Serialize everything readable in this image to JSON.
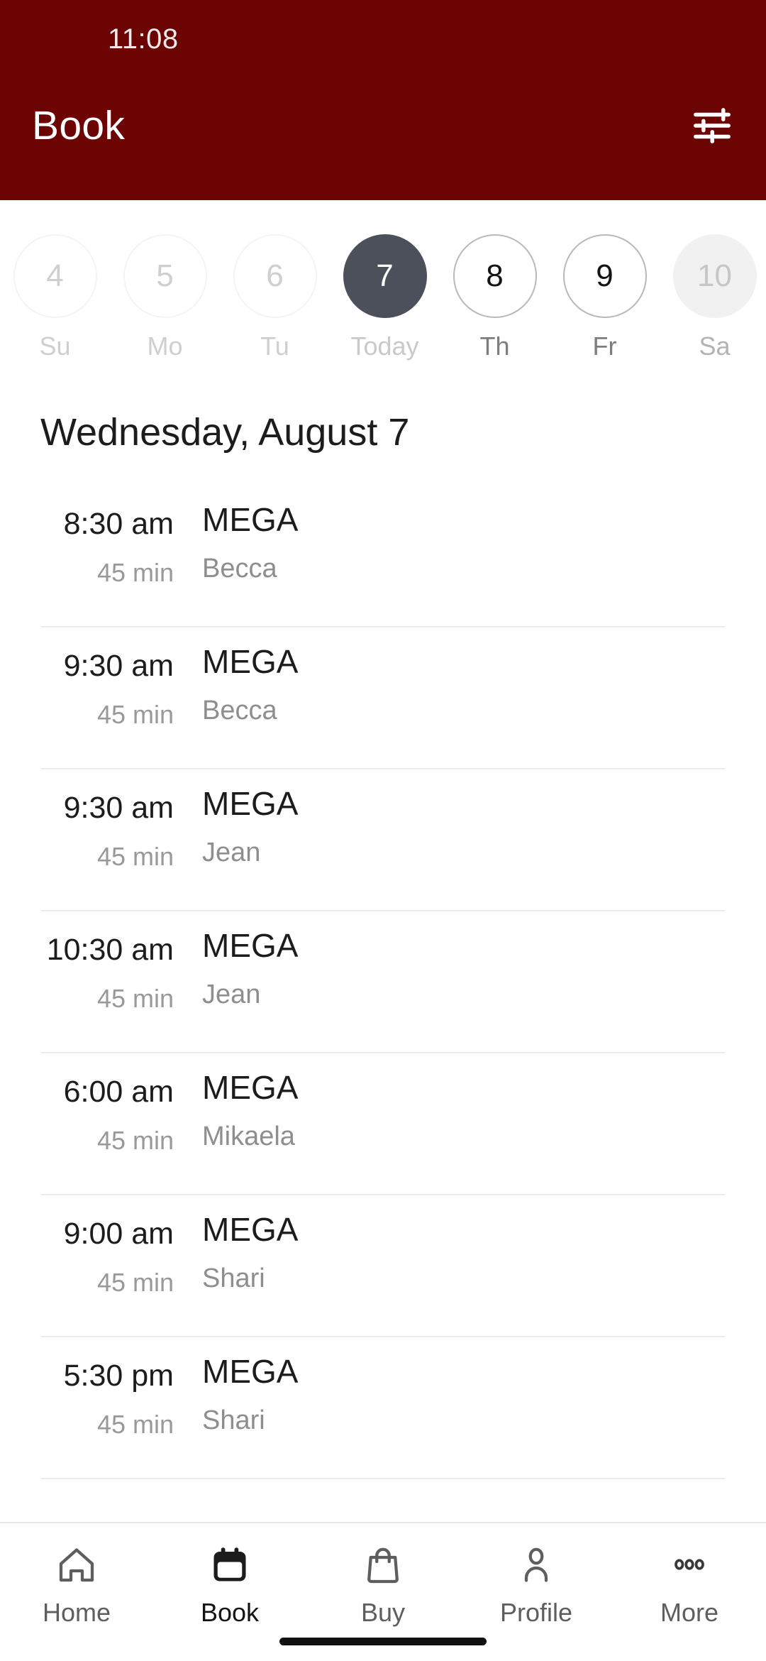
{
  "status_bar": {
    "time": "11:08"
  },
  "header": {
    "title": "Book",
    "filter_icon": "tune-filter-icon",
    "background_color": "#6B0403"
  },
  "date_strip": {
    "days": [
      {
        "number": "4",
        "label": "Su",
        "state": "disabled"
      },
      {
        "number": "5",
        "label": "Mo",
        "state": "disabled"
      },
      {
        "number": "6",
        "label": "Tu",
        "state": "disabled"
      },
      {
        "number": "7",
        "label": "Today",
        "state": "selected"
      },
      {
        "number": "8",
        "label": "Th",
        "state": "enabled"
      },
      {
        "number": "9",
        "label": "Fr",
        "state": "enabled"
      },
      {
        "number": "10",
        "label": "Sa",
        "state": "edge"
      }
    ],
    "selected_color": "#4C505A"
  },
  "schedule": {
    "date_heading": "Wednesday, August 7",
    "classes": [
      {
        "time": "8:30 am",
        "duration": "45 min",
        "name": "MEGA",
        "instructor": "Becca"
      },
      {
        "time": "9:30 am",
        "duration": "45 min",
        "name": "MEGA",
        "instructor": "Becca"
      },
      {
        "time": "9:30 am",
        "duration": "45 min",
        "name": "MEGA",
        "instructor": "Jean"
      },
      {
        "time": "10:30 am",
        "duration": "45 min",
        "name": "MEGA",
        "instructor": "Jean"
      },
      {
        "time": "6:00 am",
        "duration": "45 min",
        "name": "MEGA",
        "instructor": "Mikaela"
      },
      {
        "time": "9:00 am",
        "duration": "45 min",
        "name": "MEGA",
        "instructor": "Shari"
      },
      {
        "time": "5:30 pm",
        "duration": "45 min",
        "name": "MEGA",
        "instructor": "Shari"
      }
    ]
  },
  "bottom_nav": {
    "items": [
      {
        "label": "Home",
        "icon": "home-icon",
        "active": false
      },
      {
        "label": "Book",
        "icon": "calendar-icon",
        "active": true
      },
      {
        "label": "Buy",
        "icon": "bag-icon",
        "active": false
      },
      {
        "label": "Profile",
        "icon": "person-icon",
        "active": false
      },
      {
        "label": "More",
        "icon": "ellipsis-icon",
        "active": false
      }
    ]
  }
}
